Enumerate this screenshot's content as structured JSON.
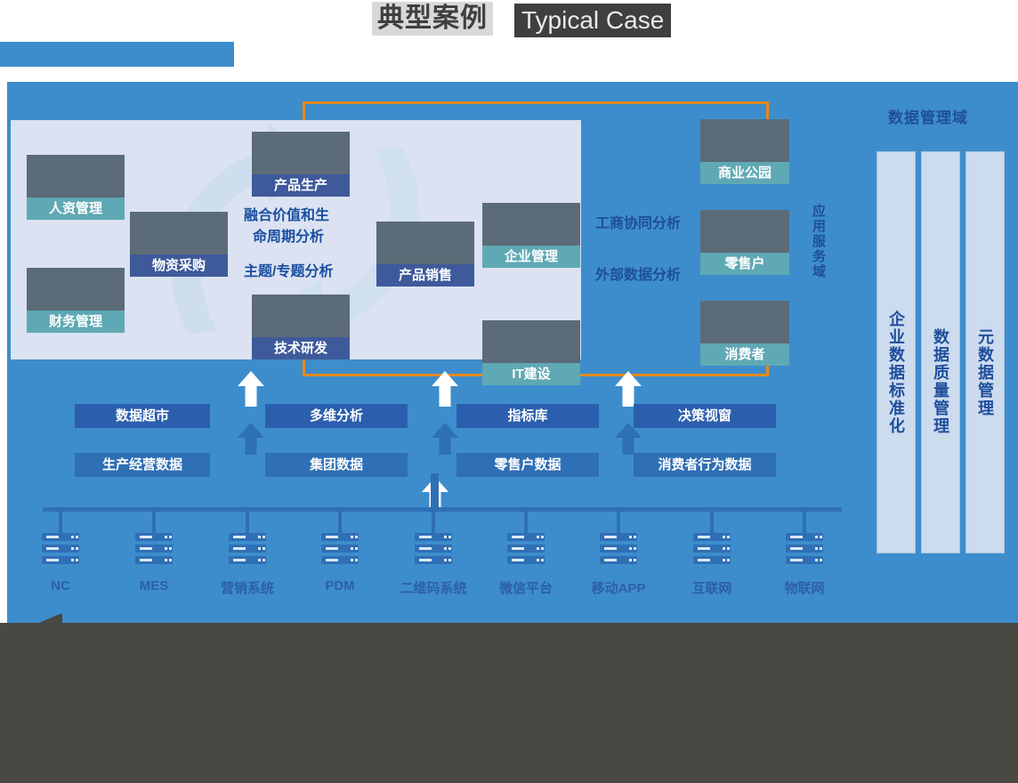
{
  "header": {
    "title_zh": "典型案例",
    "title_en": "Typical Case"
  },
  "colors": {
    "canvas_blue": "#3d8dcc",
    "panel_light": "#dbe2f2",
    "teal_tag": "#5fa9b4",
    "navy_tag": "#3e5a9b",
    "bracket_orange": "#e8891b",
    "text_blue": "#1f4e9c",
    "box_row1": "#2b5fad",
    "box_row2": "#2f6fb5",
    "overlay_gray": "#4a4843"
  },
  "panel": {
    "center_texts": [
      "融合价值和生",
      "命周期分析",
      "主题/专题分析"
    ],
    "cards": [
      {
        "id": "hr",
        "label": "人资管理",
        "tag": "teal",
        "photo": "p-hr"
      },
      {
        "id": "finance",
        "label": "财务管理",
        "tag": "teal",
        "photo": "p-fin"
      },
      {
        "id": "material",
        "label": "物资采购",
        "tag": "navy",
        "photo": "p-mat"
      },
      {
        "id": "produce",
        "label": "产品生产",
        "tag": "navy",
        "photo": "p-prod"
      },
      {
        "id": "sales",
        "label": "产品销售",
        "tag": "navy",
        "photo": "p-sale"
      },
      {
        "id": "tech",
        "label": "技术研发",
        "tag": "navy",
        "photo": "p-tech"
      },
      {
        "id": "enterprise",
        "label": "企业管理",
        "tag": "teal",
        "photo": "p-ent"
      },
      {
        "id": "it",
        "label": "IT建设",
        "tag": "teal",
        "photo": "p-it"
      }
    ]
  },
  "external": {
    "analysis_labels": [
      "工商协同分析",
      "外部数据分析"
    ],
    "cards": [
      {
        "id": "park",
        "label": "商业公园",
        "tag": "teal",
        "photo": "p-park"
      },
      {
        "id": "retailer",
        "label": "零售户",
        "tag": "teal",
        "photo": "p-retail"
      },
      {
        "id": "consumer",
        "label": "消费者",
        "tag": "teal",
        "photo": "p-cons"
      }
    ],
    "domain_label": "应用服务域"
  },
  "capabilities": {
    "row1": [
      "数据超市",
      "多维分析",
      "指标库",
      "决策视窗"
    ],
    "row2": [
      "生产经营数据",
      "集团数据",
      "零售户数据",
      "消费者行为数据"
    ]
  },
  "sources": {
    "systems": [
      "NC",
      "MES",
      "营销系统",
      "PDM",
      "二维码系统",
      "微信平台",
      "移动APP",
      "互联网",
      "物联网"
    ],
    "icon": "server-rack-icon"
  },
  "data_management": {
    "title": "数据管理域",
    "columns": [
      "企业数据标准化",
      "数据质量管理",
      "元数据管理"
    ]
  }
}
